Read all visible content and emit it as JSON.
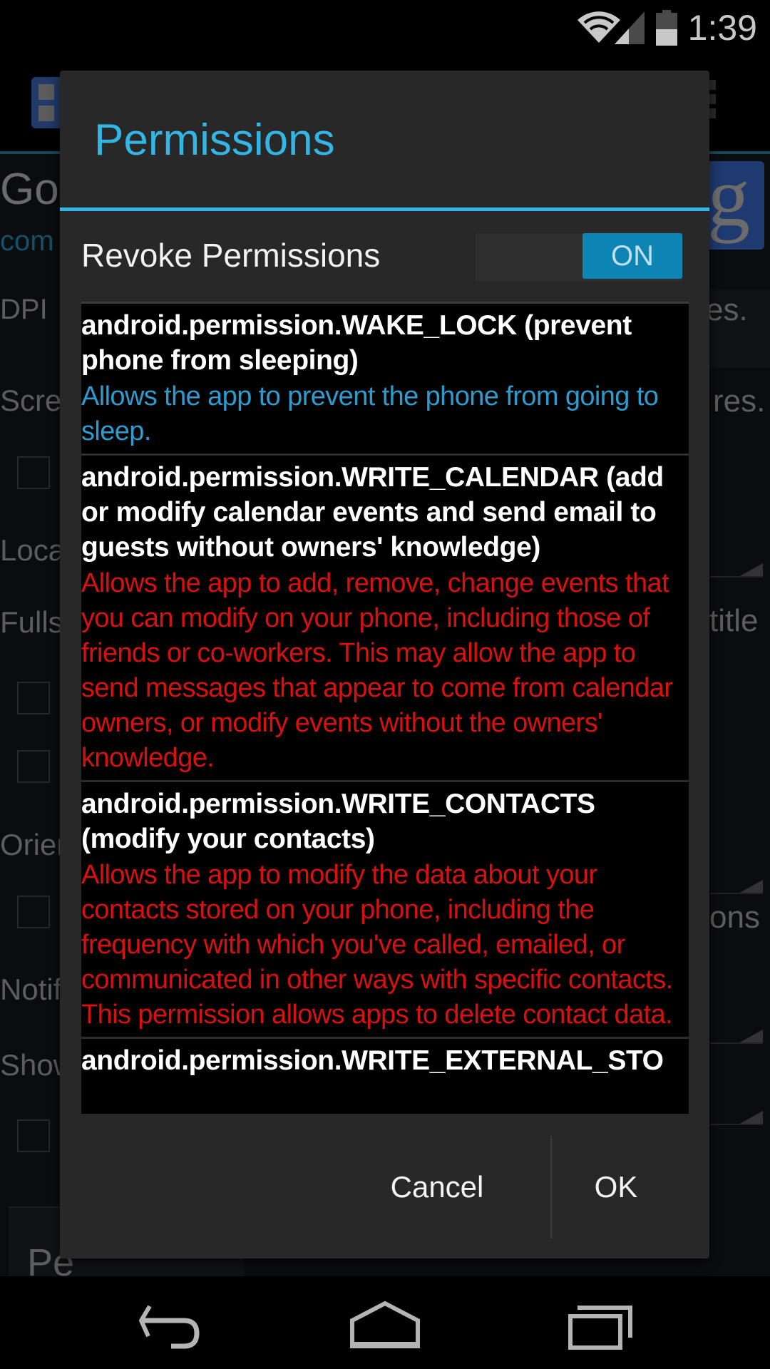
{
  "status_bar": {
    "time": "1:39",
    "icons": [
      "wifi-icon",
      "cell-signal-icon",
      "battery-icon"
    ],
    "battery_level": 0.5
  },
  "background_app": {
    "title_fragment": "Go",
    "subtitle_fragment": "com",
    "labels_left": [
      "DPI",
      "Scre",
      "Loca",
      "Fulls",
      "Orien",
      "Notif",
      "Show"
    ],
    "labels_right": [
      "es.",
      "res.",
      "title",
      "ons"
    ],
    "button_fragment": "Pe",
    "icon_letter": "g"
  },
  "dialog": {
    "title": "Permissions",
    "revoke": {
      "label": "Revoke Permissions",
      "toggle_state": "ON",
      "enabled": true
    },
    "permissions": [
      {
        "name": "android.permission.WAKE_LOCK (prevent phone from sleeping)",
        "description": "Allows the app to prevent the phone from going to sleep.",
        "severity": "normal"
      },
      {
        "name": "android.permission.WRITE_CALENDAR (add or modify calendar events and send email to guests without owners' knowledge)",
        "description": "Allows the app to add, remove, change events that you can modify on your phone, including those of friends or co-workers. This may allow the app to send messages that appear to come from calendar owners, or modify events without the owners' knowledge.",
        "severity": "dangerous"
      },
      {
        "name": "android.permission.WRITE_CONTACTS (modify your contacts)",
        "description": "Allows the app to modify the data about your contacts stored on your phone, including the frequency with which you've called, emailed, or communicated in other ways with specific contacts. This permission allows apps to delete contact data.",
        "severity": "dangerous"
      },
      {
        "name": "android.permission.WRITE_EXTERNAL_STO",
        "description": "",
        "severity": "dangerous"
      }
    ],
    "buttons": {
      "cancel": "Cancel",
      "ok": "OK"
    }
  },
  "colors": {
    "accent": "#33b5e5",
    "toggle_on": "#0e84b5",
    "normal_desc": "#2e9bcf",
    "dangerous_desc": "#d81010",
    "dialog_bg": "#282828"
  },
  "nav_bar": {
    "buttons": [
      "back-icon",
      "home-icon",
      "recent-apps-icon"
    ]
  }
}
